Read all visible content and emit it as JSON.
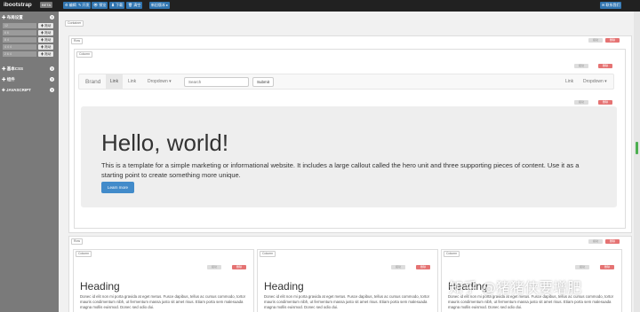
{
  "app": {
    "brand": "ibootstrap",
    "badge": "BETA"
  },
  "toolbar": {
    "buttons": [
      "编辑",
      "开发",
      "预览",
      "下载",
      "清空",
      "新旧版本"
    ],
    "right_button": "联系我们"
  },
  "sidebar": {
    "sections": [
      {
        "label": "布局设置"
      },
      {
        "label": "基本CSS"
      },
      {
        "label": "组件"
      },
      {
        "label": "JAVASCRIPT"
      }
    ],
    "layout_items": [
      "12",
      "6 6",
      "8 4",
      "4 4 4",
      "2 6 4"
    ],
    "drag_label": "拖动"
  },
  "canvas": {
    "container_label": "Container",
    "row_label": "Row",
    "column_label": "Column",
    "navbar": {
      "brand": "Brand",
      "link1": "Link",
      "link2": "Link",
      "dropdown": "Dropdown ▾",
      "search_placeholder": "Search",
      "submit": "Submit",
      "right_link": "Link",
      "right_dropdown": "Dropdown ▾"
    },
    "hero": {
      "title": "Hello, world!",
      "text": "This is a template for a simple marketing or informational website. It includes a large callout called the hero unit and three supporting pieces of content. Use it as a starting point to create something more unique.",
      "button": "Learn more"
    },
    "columns": [
      {
        "heading": "Heading",
        "text": "Donec id elit non mi porta gravida at eget metus. Fusce dapibus, tellus ac cursus commodo, tortor mauris condimentum nibh, ut fermentum massa justo sit amet risus. Etiam porta sem malesuada magna mollis euismod. Donec sed odio dui."
      },
      {
        "heading": "Heading",
        "text": "Donec id elit non mi porta gravida at eget metus. Fusce dapibus, tellus ac cursus commodo, tortor mauris condimentum nibh, ut fermentum massa justo sit amet risus. Etiam porta sem malesuada magna mollis euismod. Donec sed odio dui."
      },
      {
        "heading": "Heading",
        "text": "Donec id elit non mi porta gravida at eget metus. Fusce dapibus, tellus ac cursus commodo, tortor mauris condimentum nibh, ut fermentum massa justo sit amet risus. Etiam porta sem malesuada magna mollis euismod. Donec sed odio dui."
      }
    ],
    "box_controls": {
      "drag": "拖动",
      "delete": "删除"
    }
  },
  "watermark": "知乎 @猪猪侠要增肥",
  "colors": {
    "topbar": "#212121",
    "sidebar": "#7a7a7a",
    "primary": "#3276b1",
    "delete": "#e57373"
  }
}
